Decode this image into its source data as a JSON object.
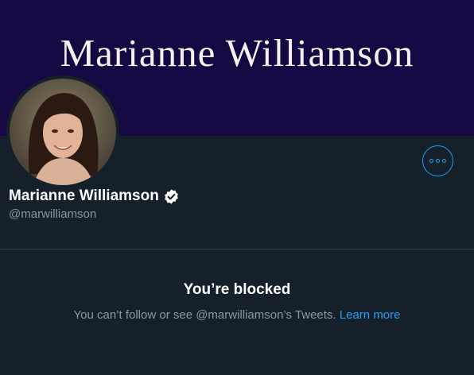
{
  "banner": {
    "title": "Marianne Williamson"
  },
  "profile": {
    "display_name": "Marianne Williamson",
    "handle": "@marwilliamson",
    "verified": true
  },
  "blocked": {
    "title": "You’re blocked",
    "message": "You can’t follow or see @marwilliamson’s Tweets.",
    "link": "Learn more"
  },
  "icons": {
    "more": "more-options-icon",
    "verified": "verified-badge-icon"
  },
  "colors": {
    "banner": "#150843",
    "background": "#15202b",
    "accent": "#1da1f2",
    "muted_text": "#8899a6",
    "divider": "#38444d"
  }
}
